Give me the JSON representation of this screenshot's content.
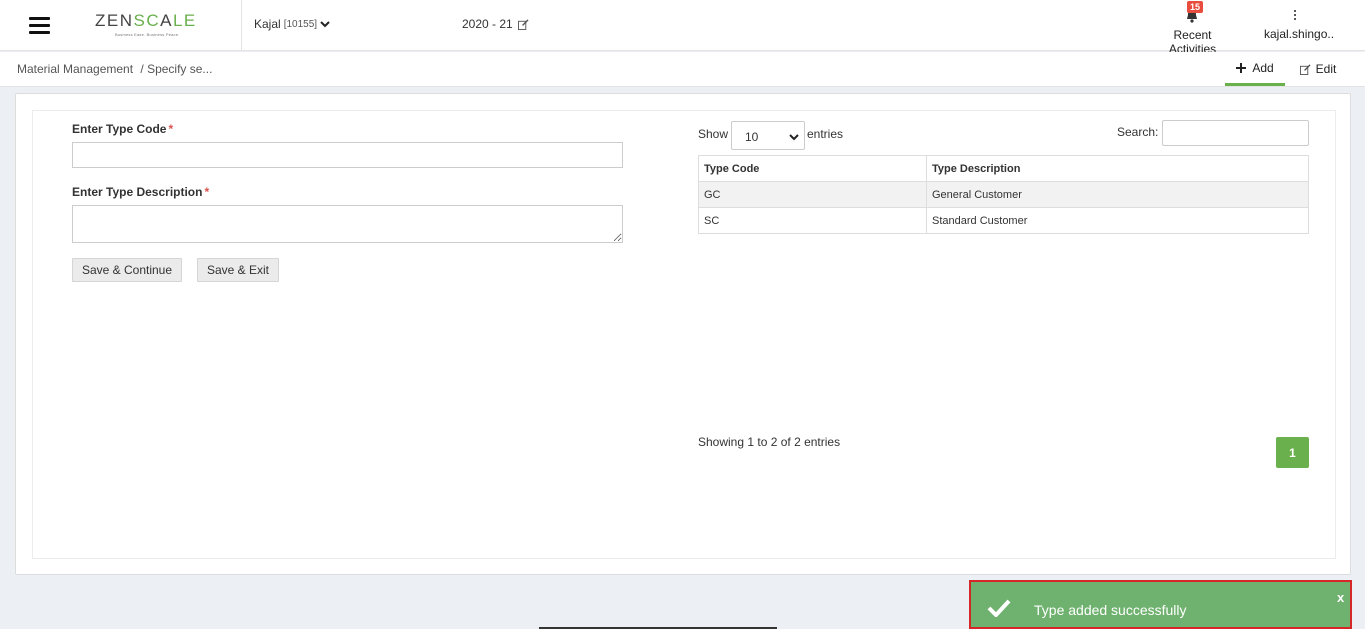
{
  "header": {
    "logo_text_a": "ZEN",
    "logo_text_b": "SC",
    "logo_text_c": "A",
    "logo_text_d": "LE",
    "logo_tagline": "Business Ease. Business Peace.",
    "company_name": "Kajal",
    "company_code": "[10155]",
    "financial_year": "2020 - 21",
    "notification_count": "15",
    "recent_activities_label": "Recent Activities",
    "user_label": "kajal.shingo.."
  },
  "subheader": {
    "breadcrumb_root": "Material Management",
    "breadcrumb_current": "/ Specify se...",
    "add_label": "Add",
    "edit_label": "Edit"
  },
  "form": {
    "type_code_label": "Enter Type Code",
    "type_code_value": "",
    "type_description_label": "Enter Type Description",
    "type_description_value": "",
    "required_marker": "*",
    "save_continue_label": "Save & Continue",
    "save_exit_label": "Save & Exit"
  },
  "table": {
    "show_label": "Show",
    "page_size": "10",
    "entries_label": "entries",
    "search_label": "Search:",
    "search_value": "",
    "columns": [
      "Type Code",
      "Type Description"
    ],
    "rows": [
      [
        "GC",
        "General Customer"
      ],
      [
        "SC",
        "Standard Customer"
      ]
    ],
    "info_text": "Showing 1 to 2 of 2 entries",
    "current_page": "1"
  },
  "toast": {
    "message": "Type added successfully",
    "close_label": "x"
  },
  "colors": {
    "accent": "#6ab04c",
    "toast_bg": "#6fb26f",
    "toast_border": "#d62728",
    "badge": "#e74c3c",
    "required": "#d9534f"
  }
}
